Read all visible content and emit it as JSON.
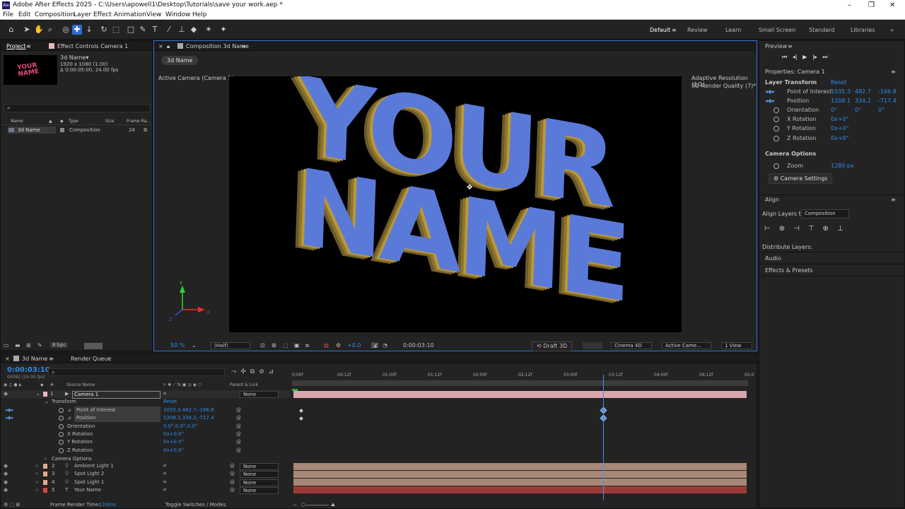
{
  "app": {
    "title": "Adobe After Effects 2025 - C:\\Users\\apowell1\\Desktop\\Tutorials\\save your work.aep *",
    "icon_text": "Ae",
    "window_controls": [
      "–",
      "❐",
      "✕"
    ]
  },
  "menu": [
    "File",
    "Edit",
    "Composition",
    "Layer",
    "Effect",
    "Animation",
    "View",
    "Window",
    "Help"
  ],
  "workspaces": [
    "Default",
    "Review",
    "Learn",
    "Small Screen",
    "Standard",
    "Libraries"
  ],
  "project": {
    "tab": "Project",
    "effect_tab": "Effect Controls Camera 1",
    "thumb_text": "YOUR NAME",
    "item_name": "3d Name▾",
    "item_res": "1920 x 1080 (1.00)",
    "item_dur": "Δ 0:00:05:00, 24.00 fps",
    "search_placeholder": "⌕",
    "columns": [
      "Name",
      "Type",
      "Size",
      "Frame Ra..."
    ],
    "rows": [
      {
        "name": "3d Name",
        "type": "Composition",
        "rate": "24"
      }
    ],
    "bpc": "8 bpc"
  },
  "comp": {
    "tab": "Composition 3d Name",
    "subtab": "3d Name",
    "camera_label": "Active Camera (Camera 1)",
    "res_info_1": "Adaptive Resolution (1/1)",
    "res_info_2": "3D Render Quality (7)*",
    "text_line1": "YOUR",
    "text_line2": "NAME",
    "axis_y": "Y",
    "axis_x": "X",
    "axis_z": "Z",
    "zoom": "50 %",
    "quality": "(Half)",
    "exposure": "+0.0",
    "timecode": "0:00:03:10",
    "draft": "Draft 3D",
    "renderer": "Cinema 4D",
    "camera": "Active Came...",
    "views": "1 View"
  },
  "timeline": {
    "tab": "3d Name",
    "render_queue": "Render Queue",
    "timecode": "0:00:03:10",
    "fps": "00082 (24.00 fps)",
    "search_placeholder": "⌕",
    "col_source": "Source Name",
    "col_parent": "Parent & Link",
    "ruler": [
      "0:00f",
      "00:12f",
      "01:00f",
      "01:12f",
      "02:00f",
      "02:12f",
      "03:00f",
      "03:12f",
      "04:00f",
      "04:12f",
      "05:0"
    ],
    "playhead_fraction": 0.686,
    "layers": [
      {
        "num": "1",
        "name": "Camera 1",
        "color": "#e9b6bd",
        "parent": "None"
      },
      {
        "num": "2",
        "name": "Ambient Light 1",
        "color": "#e2a990",
        "parent": "None"
      },
      {
        "num": "3",
        "name": "Spot Light 2",
        "color": "#e2a990",
        "parent": "None"
      },
      {
        "num": "4",
        "name": "Spot Light 1",
        "color": "#e2a990",
        "parent": "None"
      },
      {
        "num": "5",
        "name": "Your Name",
        "color": "#d04848",
        "parent": "None"
      }
    ],
    "transform": "Transform",
    "reset": "Reset",
    "props": [
      {
        "name": "Point of Interest",
        "value": "1035.3,482.7,-166.8"
      },
      {
        "name": "Position",
        "value": "1208.1,334.2,-717.4"
      },
      {
        "name": "Orientation",
        "value": "0.0°,0.0°,0.0°"
      },
      {
        "name": "X Rotation",
        "value": "0x+0.0°"
      },
      {
        "name": "Y Rotation",
        "value": "0x+0.0°"
      },
      {
        "name": "Z Rotation",
        "value": "0x+0.0°"
      }
    ],
    "camera_options": "Camera Options",
    "frame_render_label": "Frame Render Time:",
    "frame_render_value": "110ms",
    "toggle": "Toggle Switches / Modes"
  },
  "preview": {
    "tab": "Preview"
  },
  "properties": {
    "title": "Properties: Camera 1",
    "layer_transform": "Layer Transform",
    "reset": "Reset",
    "poi": {
      "label": "Point of Interest",
      "x": "1035.3",
      "y": "482.7",
      "z": "-166.8"
    },
    "position": {
      "label": "Position",
      "x": "1208.1",
      "y": "334.2",
      "z": "-717.4"
    },
    "orientation": {
      "label": "Orientation",
      "x": "0°",
      "y": "0°",
      "z": "0°"
    },
    "x_rot": {
      "label": "X Rotation",
      "value": "0x+0°"
    },
    "y_rot": {
      "label": "Y Rotation",
      "value": "0x+0°"
    },
    "z_rot": {
      "label": "Z Rotation",
      "value": "0x+0°"
    },
    "camera_options": "Camera Options",
    "zoom": {
      "label": "Zoom",
      "value": "1280 px"
    },
    "camera_settings": "Camera Settings"
  },
  "align": {
    "title": "Align",
    "align_to_label": "Align Layers to:",
    "align_to_value": "Composition",
    "distribute": "Distribute Layers:",
    "audio": "Audio",
    "effects": "Effects & Presets"
  }
}
